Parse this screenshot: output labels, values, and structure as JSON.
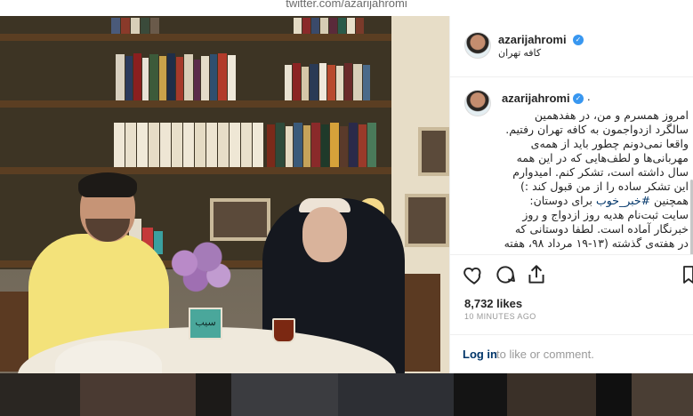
{
  "top_bar": {
    "url_text": "twitter.com/azarijahromi"
  },
  "post_header": {
    "username": "azarijahromi",
    "verified_glyph": "✓",
    "location": "کافه تهران",
    "more_glyph": "⋮",
    "avatar_icon": "profile-avatar"
  },
  "caption": {
    "username": "azarijahromi",
    "verified_glyph": "✓",
    "dot": ".",
    "lines": [
      "امروز همسرم و من، در هفدهمین",
      "سالگرد ازدواجمون به کافه تهران رفتیم.",
      "واقعا نمی‌دونم چطور باید از همه‌ی",
      "مهربانی‌ها و لطف‌هایی که در این همه",
      "سال داشته است، تشکر کنم. امیدوارم",
      "این تشکر ساده را از من قبول کند :)",
      "همچنین #خبر_خوب برای دوستان:",
      "سایت ثبت‌نام هدیه روز ازدواج و روز",
      "خبرنگار آماده است. لطفا دوستانی که",
      "در هفته‌ی گذشته (۱۳-۱۹ مرداد ۹۸، هفته"
    ],
    "hashtag": "#خبر_خوب"
  },
  "actions": {
    "icons": [
      "heart-icon",
      "comment-icon",
      "share-icon",
      "bookmark-icon"
    ]
  },
  "likes": "8,732 likes",
  "time": "10 MINUTES AGO",
  "login": {
    "link": "Log in",
    "rest": "to like or comment."
  },
  "photo_sign_text": "سیب",
  "colors": {
    "link": "#003569",
    "verified": "#3897f0",
    "muted": "#999999",
    "text": "#262626"
  }
}
